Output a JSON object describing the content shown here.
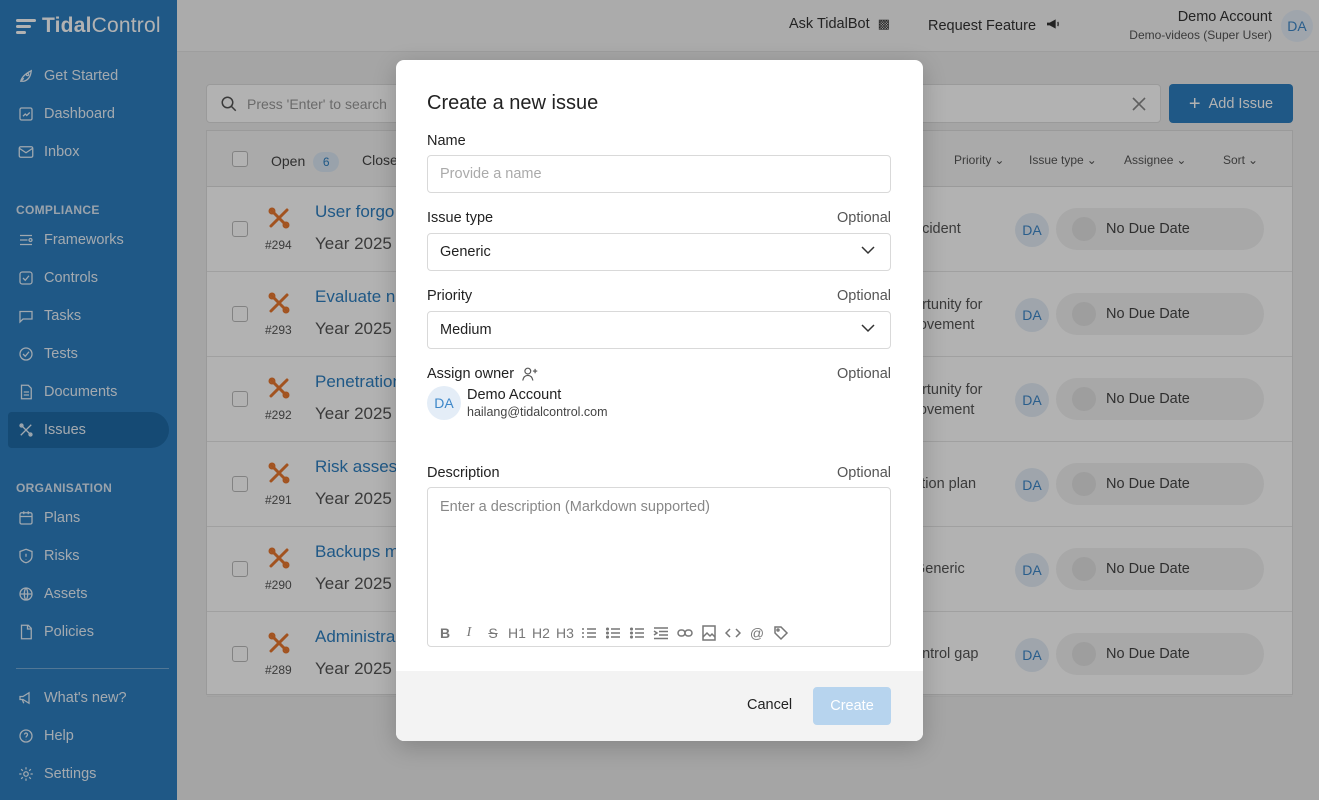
{
  "brand": {
    "name_a": "Tidal",
    "name_b": "Control"
  },
  "nav": {
    "top": [
      {
        "label": "Get Started",
        "icon": "rocket-icon"
      },
      {
        "label": "Dashboard",
        "icon": "dashboard-icon"
      },
      {
        "label": "Inbox",
        "icon": "inbox-icon"
      }
    ],
    "compliance_heading": "COMPLIANCE",
    "compliance": [
      {
        "label": "Frameworks",
        "icon": "frameworks-icon"
      },
      {
        "label": "Controls",
        "icon": "controls-icon"
      },
      {
        "label": "Tasks",
        "icon": "tasks-icon"
      },
      {
        "label": "Tests",
        "icon": "tests-icon"
      },
      {
        "label": "Documents",
        "icon": "documents-icon"
      },
      {
        "label": "Issues",
        "icon": "issues-icon",
        "active": true
      }
    ],
    "organisation_heading": "ORGANISATION",
    "organisation": [
      {
        "label": "Plans",
        "icon": "plans-icon"
      },
      {
        "label": "Risks",
        "icon": "risks-icon"
      },
      {
        "label": "Assets",
        "icon": "assets-icon"
      },
      {
        "label": "Policies",
        "icon": "policies-icon"
      }
    ],
    "bottom": [
      {
        "label": "What's new?",
        "icon": "megaphone-icon"
      },
      {
        "label": "Help",
        "icon": "help-icon"
      },
      {
        "label": "Settings",
        "icon": "gear-icon"
      }
    ]
  },
  "topbar": {
    "ask": "Ask TidalBot",
    "request": "Request Feature",
    "account_name": "Demo Account",
    "account_role": "Demo-videos (Super User)",
    "avatar": "DA"
  },
  "main": {
    "search_placeholder": "Press 'Enter' to search",
    "add_issue": "Add Issue",
    "tabs": {
      "open": "Open",
      "open_count": "6",
      "closed": "Close"
    },
    "columns": {
      "priority": "Priority",
      "issue_type": "Issue type",
      "assignee": "Assignee",
      "sort": "Sort"
    },
    "rows": [
      {
        "num": "#294",
        "title": "User forgo",
        "sub": "Year 2025",
        "type": "ncident",
        "type2": "",
        "assignee": "DA",
        "due": "No Due Date"
      },
      {
        "num": "#293",
        "title": "Evaluate ne",
        "sub": "Year 2025",
        "type": "ortunity for",
        "type2": "rovement",
        "assignee": "DA",
        "due": "No Due Date"
      },
      {
        "num": "#292",
        "title": "Penetration",
        "sub": "Year 2025",
        "type": "ortunity for",
        "type2": "rovement",
        "assignee": "DA",
        "due": "No Due Date"
      },
      {
        "num": "#291",
        "title": "Risk asses",
        "sub": "Year 2025",
        "type": "ction plan",
        "type2": "",
        "assignee": "DA",
        "due": "No Due Date"
      },
      {
        "num": "#290",
        "title": "Backups m",
        "sub": "Year 2025",
        "type": "Generic",
        "type2": "",
        "assignee": "DA",
        "due": "No Due Date"
      },
      {
        "num": "#289",
        "title": "Administra",
        "sub": "Year 2025",
        "type": "ontrol gap",
        "type2": "",
        "assignee": "DA",
        "due": "No Due Date"
      }
    ]
  },
  "modal": {
    "title": "Create a new issue",
    "name_label": "Name",
    "name_placeholder": "Provide a name",
    "issue_type_label": "Issue type",
    "optional": "Optional",
    "issue_type_value": "Generic",
    "priority_label": "Priority",
    "priority_value": "Medium",
    "owner_label": "Assign owner",
    "owner_avatar": "DA",
    "owner_name": "Demo Account",
    "owner_email": "hailang@tidalcontrol.com",
    "description_label": "Description",
    "description_placeholder": "Enter a description (Markdown supported)",
    "toolbar": {
      "h1": "H1",
      "h2": "H2",
      "h3": "H3",
      "at": "@"
    },
    "cancel": "Cancel",
    "create": "Create"
  },
  "colors": {
    "brand": "#2d7fc1",
    "sidebar_active": "#1f6aa6",
    "issue_icon": "#e8772e",
    "create_disabled": "#b7d4ee"
  }
}
